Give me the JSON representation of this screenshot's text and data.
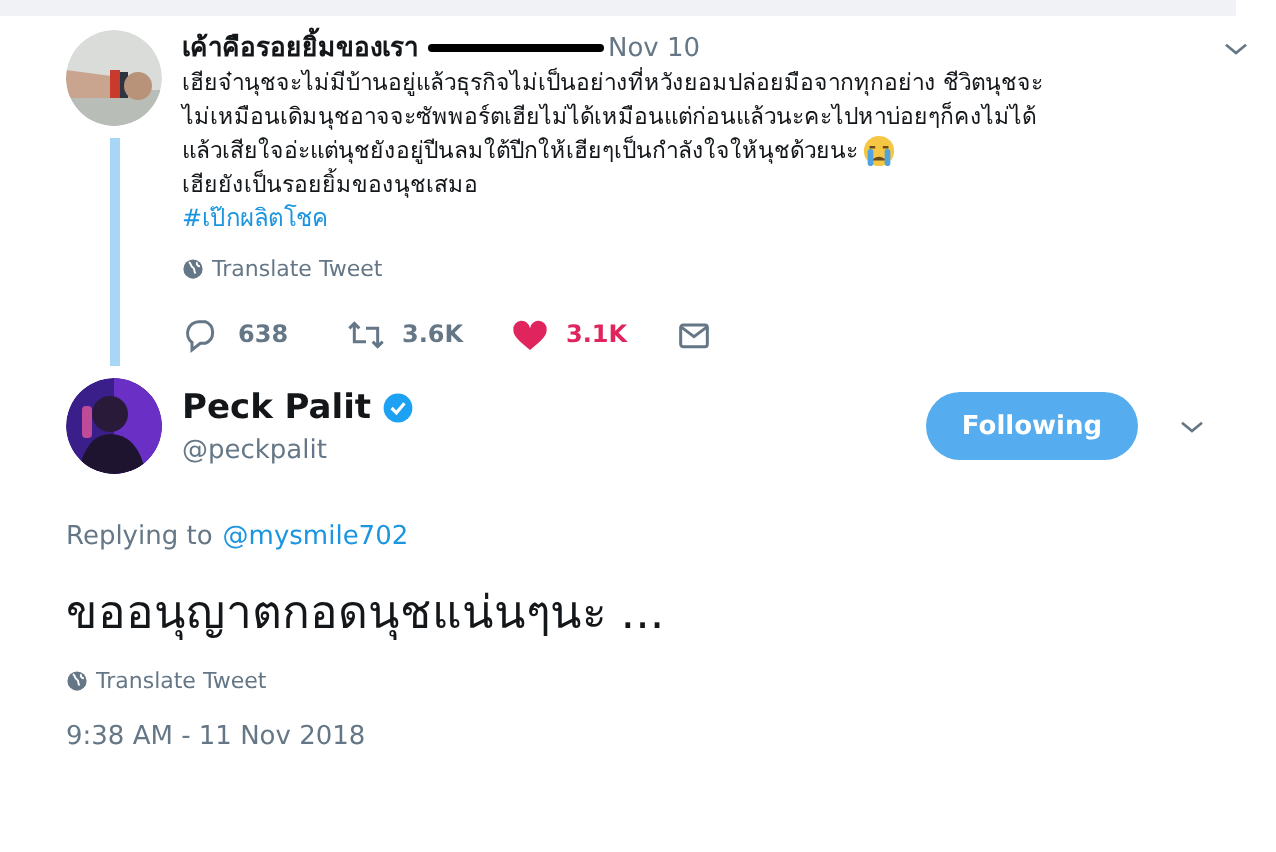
{
  "quoted_tweet": {
    "name": "เค้าคือรอยยิ้มของเรา",
    "handle_redacted": true,
    "date": "Nov 10",
    "lines": [
      "เฮียจ๋านุชจะไม่มีบ้านอยู่แล้วธุรกิจไม่เป็นอย่างที่หวังยอมปล่อยมือจากทุกอย่าง ชีวิตนุชจะ",
      "ไม่เหมือนเดิมนุชอาจจะซัพพอร์ตเฮียไม่ได้เหมือนแต่ก่อนแล้วนะคะไปหาบ่อยๆก็คงไม่ได้",
      "แล้วเสียใจอ่ะแต่นุชยังอยู่ปีนลมใต้ปีกให้เฮียๆเป็นกำลังใจให้นุชด้วยนะ",
      "เฮียยังเป็นรอยยิ้มของนุชเสมอ"
    ],
    "hashtag": "#เป๊กผลิตโชค",
    "translate": "Translate Tweet",
    "actions": [
      {
        "kind": "reply",
        "count": "638",
        "on": false
      },
      {
        "kind": "retweet",
        "count": "3.6K",
        "on": false
      },
      {
        "kind": "like",
        "count": "3.1K",
        "on": true
      },
      {
        "kind": "message",
        "on": false
      }
    ]
  },
  "main_tweet": {
    "name": "Peck Palit",
    "verified": true,
    "handle": "@peckpalit",
    "follow_button": "Following",
    "replying_label": "Replying to",
    "replying_to": "@mysmile702",
    "text": "ขออนุญาตกอดนุชแน่นๆนะ ...",
    "translate": "Translate Tweet",
    "timestamp": "9:38 AM - 11 Nov 2018"
  }
}
